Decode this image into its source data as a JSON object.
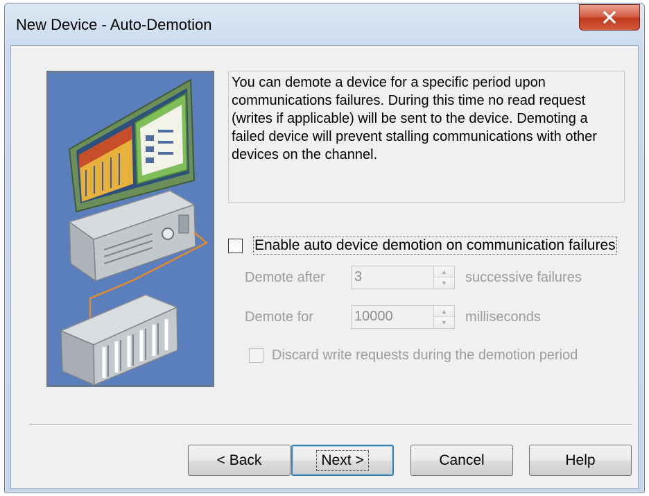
{
  "window": {
    "title": "New Device - Auto-Demotion",
    "close_icon": "close-x-icon"
  },
  "description": "You can demote a device for a specific period upon communications failures. During this time no read request (writes if applicable) will be sent to the device. Demoting a failed device will prevent stalling communications with other devices on the channel.",
  "enable": {
    "label": "Enable auto device demotion on communication failures",
    "checked": false
  },
  "demote_after": {
    "label": "Demote after",
    "value": "3",
    "suffix": "successive failures"
  },
  "demote_for": {
    "label": "Demote for",
    "value": "10000",
    "suffix": "milliseconds"
  },
  "discard": {
    "label": "Discard write requests during the demotion period",
    "checked": false
  },
  "buttons": {
    "back": "< Back",
    "next": "Next >",
    "cancel": "Cancel",
    "help": "Help"
  },
  "colors": {
    "image_bg": "#5b7fbd",
    "close_red": "#c1391d",
    "disabled_text": "#9c9c9c"
  }
}
